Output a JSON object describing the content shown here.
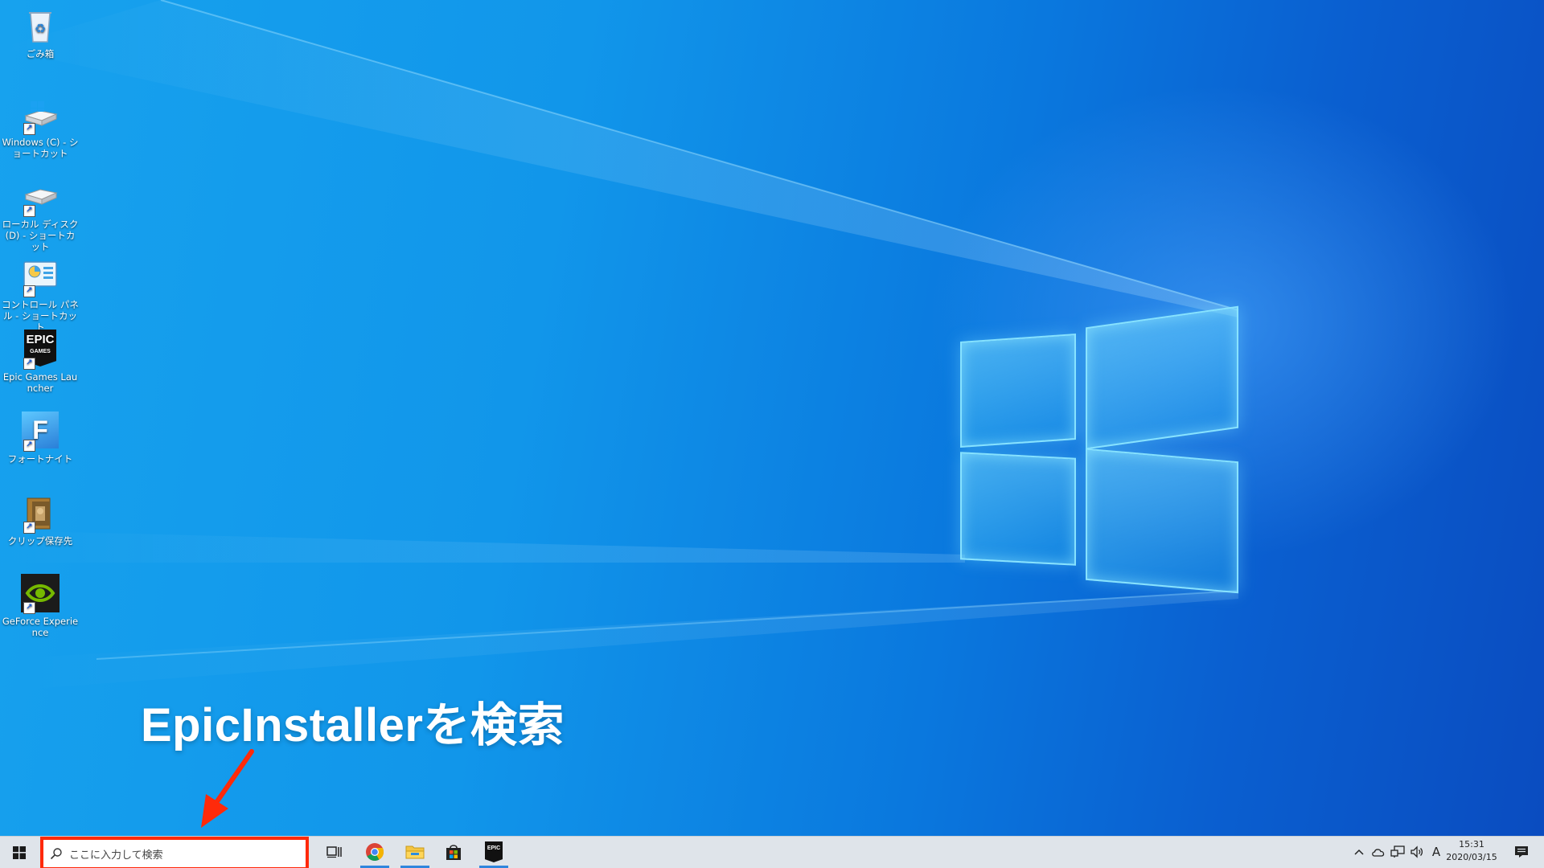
{
  "desktop": {
    "icons": [
      {
        "label": "ごみ箱",
        "icon": "recycle-bin-icon"
      },
      {
        "label": "Windows (C) - ショートカット",
        "icon": "drive-icon"
      },
      {
        "label": "ローカル ディスク (D) - ショートカット",
        "icon": "drive-icon"
      },
      {
        "label": "コントロール パネル - ショートカット",
        "icon": "control-panel-icon"
      },
      {
        "label": "Epic Games Launcher",
        "icon": "epic-games-icon"
      },
      {
        "label": "フォートナイト",
        "icon": "fortnite-icon"
      },
      {
        "label": "クリップ保存先",
        "icon": "folder-icon"
      },
      {
        "label": "GeForce Experience",
        "icon": "nvidia-icon"
      }
    ],
    "epic_logo_text": "EPIC",
    "epic_logo_sub": "GAMES",
    "fortnite_letter": "F"
  },
  "annotation": {
    "text": "EpicInstallerを検索",
    "arrow_color": "#ff2a0a"
  },
  "taskbar": {
    "search_placeholder": "ここに入力して検索",
    "apps": [
      {
        "name": "task-view",
        "icon": "task-view-icon"
      },
      {
        "name": "chrome",
        "icon": "chrome-icon"
      },
      {
        "name": "file-explorer",
        "icon": "folder-icon"
      },
      {
        "name": "store",
        "icon": "store-icon"
      },
      {
        "name": "epic-games",
        "icon": "epic-games-icon"
      }
    ],
    "tray": {
      "ime": "A",
      "time": "15:31",
      "date": "2020/03/15"
    }
  },
  "colors": {
    "desktop_blue": "#1196ea",
    "taskbar": "#dfe4ea",
    "highlight_red": "#ff2a0a",
    "running_indicator": "#2f86dd"
  }
}
